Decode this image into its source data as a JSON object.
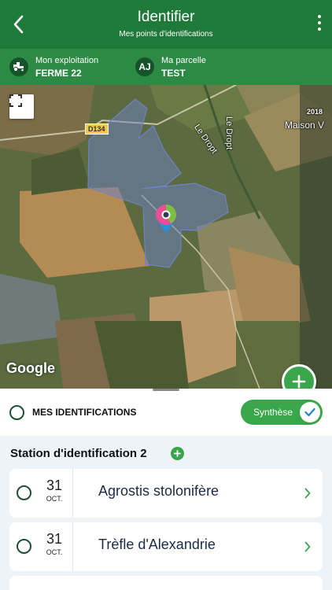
{
  "header": {
    "title": "Identifier",
    "subtitle": "Mes points d'identifications"
  },
  "context": {
    "farm": {
      "label": "Mon exploitation",
      "value": "FERME 22"
    },
    "parcel": {
      "label": "Ma parcelle",
      "value": "TEST",
      "initials": "AJ"
    }
  },
  "map": {
    "road_label": "D134",
    "river_label_1": "Le Dropt",
    "river_label_2": "Le Dropt",
    "year_label": "2018",
    "place_label": "Maison V",
    "provider": "Google"
  },
  "sheet": {
    "mes_label": "MES IDENTIFICATIONS",
    "synthese_label": "Synthèse",
    "station_title": "Station d'identification 2",
    "items": [
      {
        "day": "31",
        "month": "OCT.",
        "name": "Agrostis stolonifère"
      },
      {
        "day": "31",
        "month": "OCT.",
        "name": "Trèfle d'Alexandrie"
      }
    ]
  },
  "colors": {
    "header": "#1f7a3a",
    "context_bar": "#2d8a44",
    "accent_green": "#3aa64b",
    "parcel_fill": "#6f82c8",
    "pin_pink": "#e94f96",
    "pin_green": "#7bc043",
    "pin_blue": "#2a8fd6"
  },
  "icons": {
    "back": "chevron-left-icon",
    "menu": "more-vertical-icon",
    "farm": "tractor-icon",
    "fullscreen": "fullscreen-icon",
    "add": "plus-icon",
    "check": "check-icon",
    "chevron": "chevron-right-icon",
    "pin": "map-pin-icon"
  }
}
